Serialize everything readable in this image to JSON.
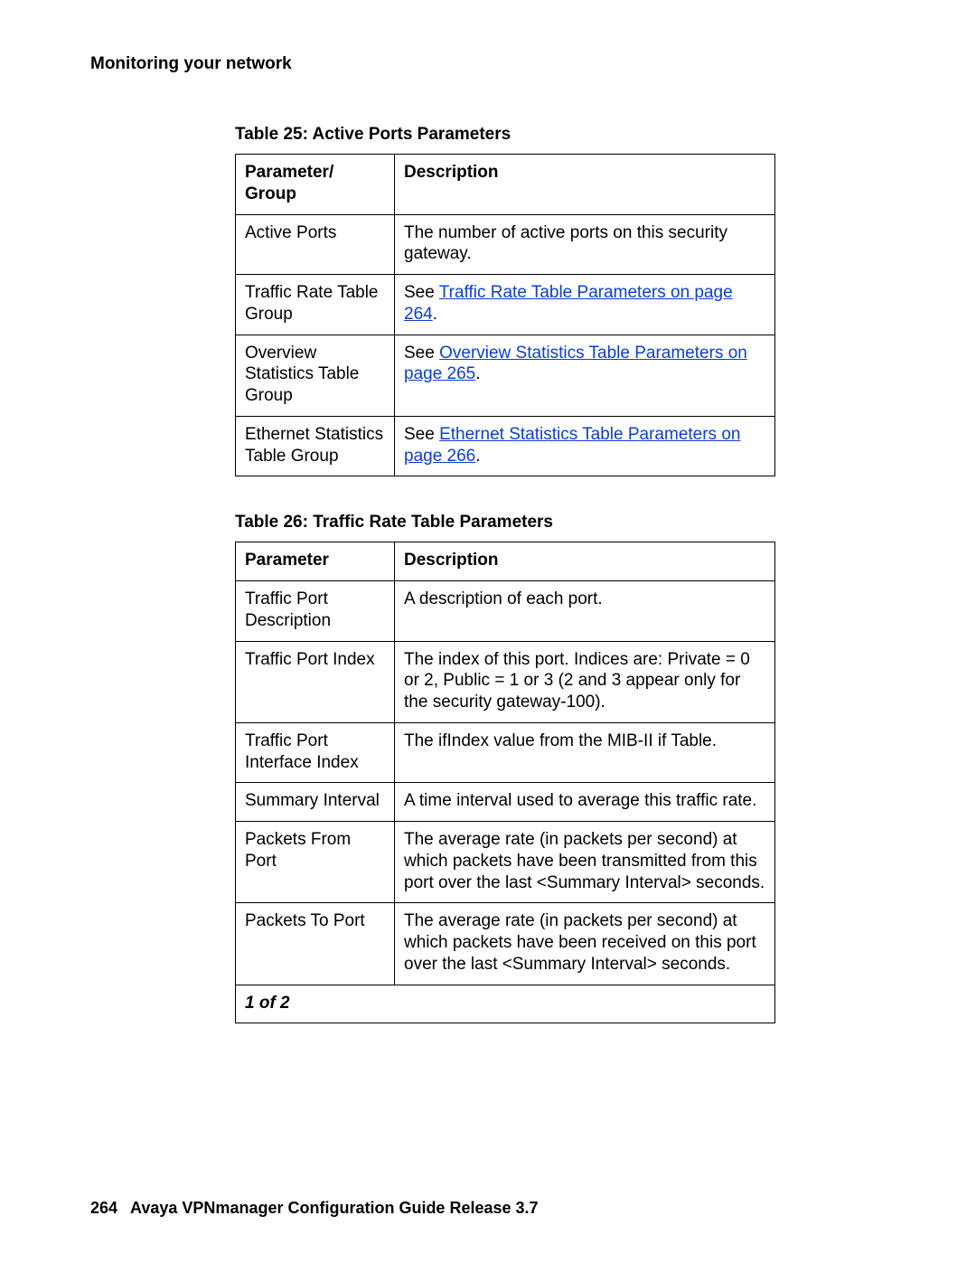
{
  "header": {
    "section": "Monitoring your network"
  },
  "tables": {
    "t25": {
      "caption": "Table 25: Active Ports Parameters",
      "col1": "Parameter/ Group",
      "col2": "Description",
      "rows": [
        {
          "param": "Active Ports",
          "desc_plain": "The number of active ports on this security gateway."
        },
        {
          "param": "Traffic Rate Table Group",
          "desc_prefix": "See ",
          "link": "Traffic Rate Table Parameters on page 264",
          "desc_suffix": "."
        },
        {
          "param": "Overview Statistics Table Group",
          "desc_prefix": "See ",
          "link": "Overview Statistics Table Parameters on page 265",
          "desc_suffix": "."
        },
        {
          "param": "Ethernet Statistics Table Group",
          "desc_prefix": "See ",
          "link": "Ethernet Statistics Table Parameters on page 266",
          "desc_suffix": "."
        }
      ]
    },
    "t26": {
      "caption": "Table 26: Traffic Rate Table Parameters",
      "col1": "Parameter",
      "col2": "Description",
      "rows": [
        {
          "param": "Traffic Port Description",
          "desc": "A description of each port."
        },
        {
          "param": "Traffic Port Index",
          "desc": "The index of this port. Indices are: Private = 0 or 2, Public = 1 or 3 (2 and 3 appear only for the security gateway-100)."
        },
        {
          "param": "Traffic Port Interface Index",
          "desc": "The ifIndex value from the MIB-II if Table."
        },
        {
          "param": "Summary Interval",
          "desc": "A time interval used to average this traffic rate."
        },
        {
          "param": "Packets From Port",
          "desc": "The average rate (in packets per second) at which packets have been transmitted from this port over the last <Summary Interval> seconds."
        },
        {
          "param": "Packets To Port",
          "desc": "The average rate (in packets per second) at which packets have been received on this port over the last <Summary Interval> seconds."
        }
      ],
      "pager": "1 of 2"
    }
  },
  "footer": {
    "page": "264",
    "title": "Avaya VPNmanager Configuration Guide Release 3.7"
  }
}
